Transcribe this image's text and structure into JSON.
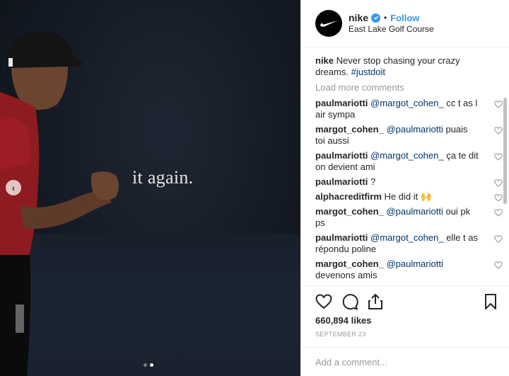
{
  "media": {
    "slogan": "it again.",
    "carousel": {
      "count": 2,
      "active_index": 1
    }
  },
  "post": {
    "account": {
      "handle": "nike",
      "verified": true,
      "separator": "•",
      "follow_label": "Follow"
    },
    "location": "East Lake Golf Course",
    "caption": {
      "user": "nike",
      "text": "Never stop chasing your crazy dreams.",
      "hashtag": "#justdoit"
    },
    "load_more_label": "Load more comments",
    "comments": [
      {
        "user": "paulmariotti",
        "mention": "@margot_cohen_",
        "text": "cc t as l air sympa"
      },
      {
        "user": "margot_cohen_",
        "mention": "@paulmariotti",
        "text": "puais toi aussi"
      },
      {
        "user": "paulmariotti",
        "mention": "@margot_cohen_",
        "text": "ça te dit on devient ami"
      },
      {
        "user": "paulmariotti",
        "mention": "",
        "text": "?"
      },
      {
        "user": "alphacreditfirm",
        "mention": "",
        "text": "He did it 🙌"
      },
      {
        "user": "margot_cohen_",
        "mention": "@paulmariotti",
        "text": "oui pk ps"
      },
      {
        "user": "paulmariotti",
        "mention": "@margot_cohen_",
        "text": "elle t as répondu poline"
      },
      {
        "user": "margot_cohen_",
        "mention": "@paulmariotti",
        "text": "devenons amis"
      }
    ],
    "likes": "660,894 likes",
    "date": "SEPTEMBER 23",
    "add_comment_placeholder": "Add a comment..."
  },
  "colors": {
    "link": "#3897f0",
    "mention": "#003569",
    "muted": "#999999",
    "media_bg": "#141a24"
  },
  "icons": [
    "heart-icon",
    "comment-icon",
    "share-icon",
    "bookmark-icon",
    "verified-icon",
    "chevron-left-icon",
    "nike-swoosh-icon"
  ]
}
